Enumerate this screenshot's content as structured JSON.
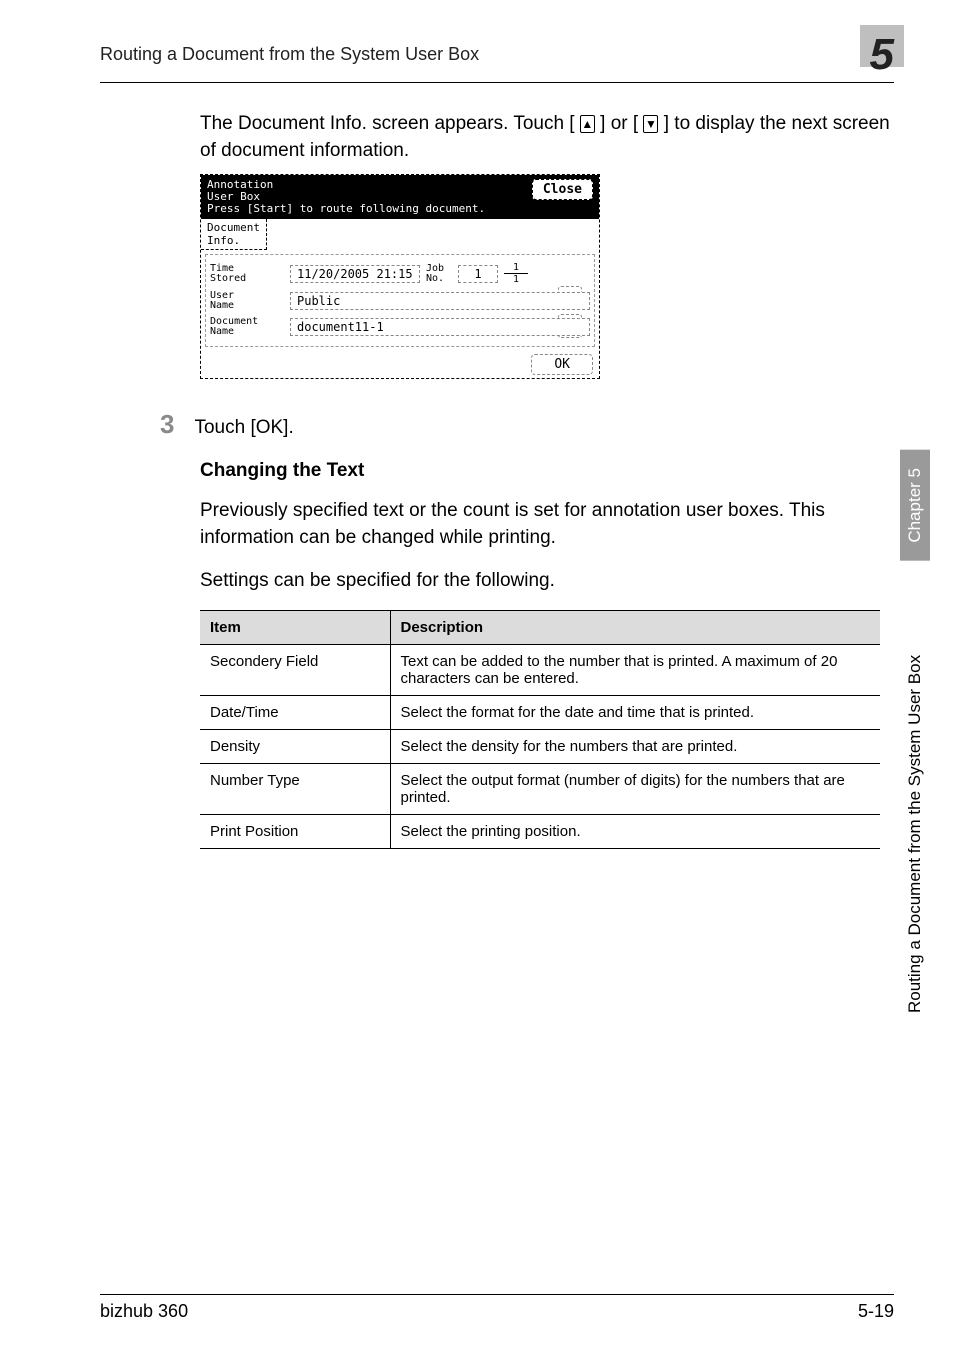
{
  "header": {
    "title": "Routing a Document from the System User Box",
    "chapter_number": "5"
  },
  "intro_text": "The Document Info. screen appears. Touch [ ↑ ] or [ ↓ ] to display the next screen of document information.",
  "panel": {
    "title_line1": "Annotation",
    "title_line2": "User Box",
    "instruction": "Press [Start] to route following document.",
    "close_label": "Close",
    "tab_label": "Document\nInfo.",
    "rows": {
      "time_stored": {
        "label": "Time\nStored",
        "value": "11/20/2005 21:15"
      },
      "job_no": {
        "label": "Job\nNo.",
        "value": "1"
      },
      "user_name": {
        "label": "User\nName",
        "value": "Public"
      },
      "doc_name": {
        "label": "Document\nName",
        "value": "document11-1"
      }
    },
    "pager": {
      "current": "1",
      "total": "1"
    },
    "ok_label": "OK"
  },
  "step": {
    "number": "3",
    "text": "Touch [OK]."
  },
  "section": {
    "heading": "Changing the Text",
    "para1": "Previously specified text or the count is set for annotation user boxes. This information can be changed while printing.",
    "para2": "Settings can be specified for the following."
  },
  "table": {
    "head": {
      "item": "Item",
      "desc": "Description"
    },
    "rows": [
      {
        "item": "Secondery Field",
        "desc": "Text can be added to the number that is printed. A maximum of 20 characters can be entered."
      },
      {
        "item": "Date/Time",
        "desc": "Select the format for the date and time that is printed."
      },
      {
        "item": "Density",
        "desc": "Select the density for the numbers that are printed."
      },
      {
        "item": "Number Type",
        "desc": "Select the output format (number of digits) for the numbers that are printed."
      },
      {
        "item": "Print Position",
        "desc": "Select the printing position."
      }
    ]
  },
  "side": {
    "chapter": "Chapter 5",
    "title": "Routing a Document from the System User Box"
  },
  "footer": {
    "left": "bizhub 360",
    "right": "5-19"
  }
}
